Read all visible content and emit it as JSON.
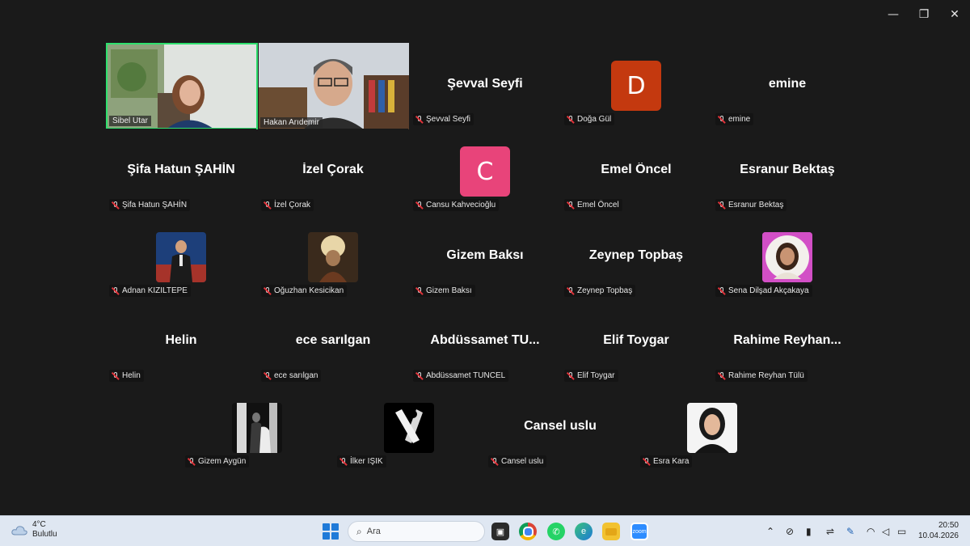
{
  "window": {
    "minimize": "—",
    "restore": "❐",
    "close": "✕"
  },
  "self_video": {
    "name": "Sibel Utar"
  },
  "video2": {
    "name": "Hakan Arıdemir"
  },
  "tiles": [
    {
      "big": "Şevval Seyfi",
      "label": "Şevval Seyfi"
    },
    {
      "letter": "D",
      "color": "#c4390f",
      "label": "Doğa Gül"
    },
    {
      "big": "emine",
      "label": "emine"
    },
    {
      "big": "Şifa Hatun ŞAHİN",
      "label": "Şifa Hatun ŞAHİN"
    },
    {
      "big": "İzel Çorak",
      "label": "İzel Çorak"
    },
    {
      "letter": "C",
      "color": "#e8447a",
      "label": "Cansu Kahvecioğlu"
    },
    {
      "big": "Emel Öncel",
      "label": "Emel Öncel"
    },
    {
      "big": "Esranur Bektaş",
      "label": "Esranur Bektaş"
    },
    {
      "label": "Adnan KIZILTEPE"
    },
    {
      "label": "Oğuzhan Kesicikan"
    },
    {
      "big": "Gizem Baksı",
      "label": "Gizem Baksı"
    },
    {
      "big": "Zeynep Topbaş",
      "label": "Zeynep Topbaş"
    },
    {
      "label": "Sena Dilşad Akçakaya"
    },
    {
      "big": "Helin",
      "label": "Helin"
    },
    {
      "big": "ece sarılgan",
      "label": "ece sarılgan"
    },
    {
      "big": "Abdüssamet  TU...",
      "label": "Abdüssamet TUNCEL"
    },
    {
      "big": "Elif Toygar",
      "label": "Elif Toygar"
    },
    {
      "big": "Rahime  Reyhan...",
      "label": "Rahime Reyhan Tülü"
    },
    {
      "label": "Gizem Aygün"
    },
    {
      "label": "İlker IŞIK"
    },
    {
      "big": "Cansel uslu",
      "label": "Cansel uslu"
    },
    {
      "label": "Esra Kara"
    }
  ],
  "taskbar": {
    "weather_temp": "4°C",
    "weather_desc": "Bulutlu",
    "search_placeholder": "Ara",
    "time": "20:50",
    "date": "10.04.2026"
  }
}
